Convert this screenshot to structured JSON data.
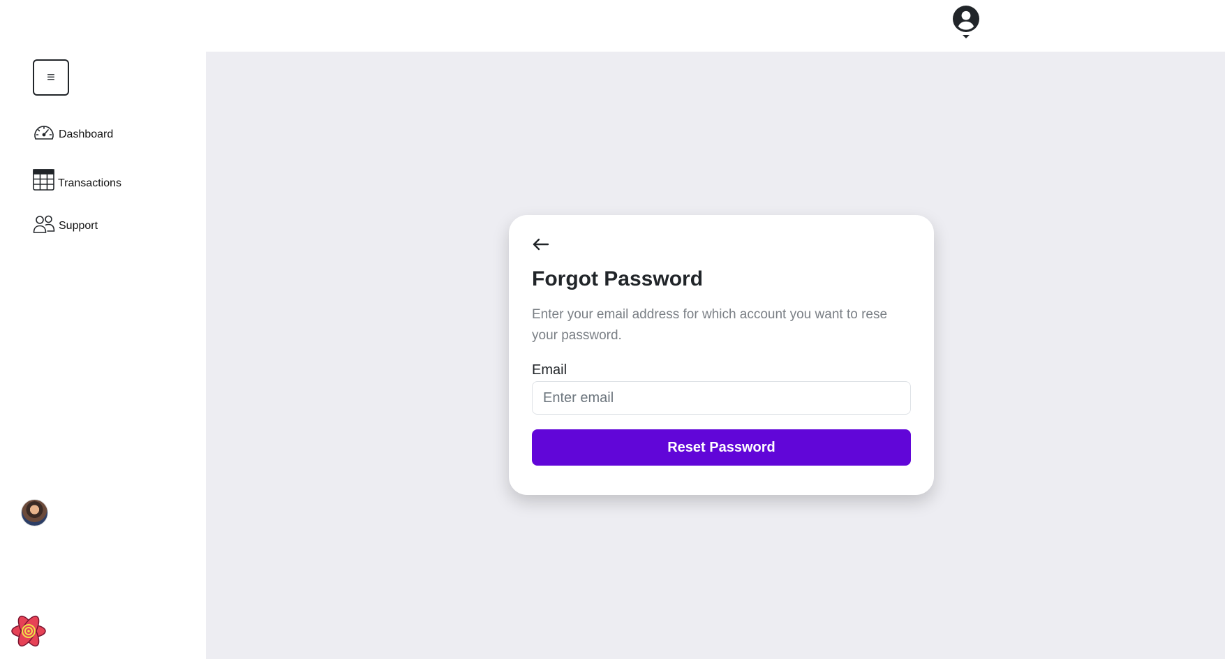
{
  "sidebar": {
    "menu_toggle_glyph": "≡",
    "items": [
      {
        "label": "Dashboard",
        "icon": "speedometer-icon"
      },
      {
        "label": "Transactions",
        "icon": "table-icon"
      },
      {
        "label": "Support",
        "icon": "people-icon"
      }
    ]
  },
  "forgot_password": {
    "title": "Forgot Password",
    "description": "Enter your email address for which account you want to rese your password.",
    "email_label": "Email",
    "email_placeholder": "Enter email",
    "email_value": "",
    "submit_label": "Reset Password"
  },
  "colors": {
    "accent": "#6106d8",
    "main_background": "#ededf2",
    "text": "#212529",
    "muted_text": "#7a7f85"
  }
}
